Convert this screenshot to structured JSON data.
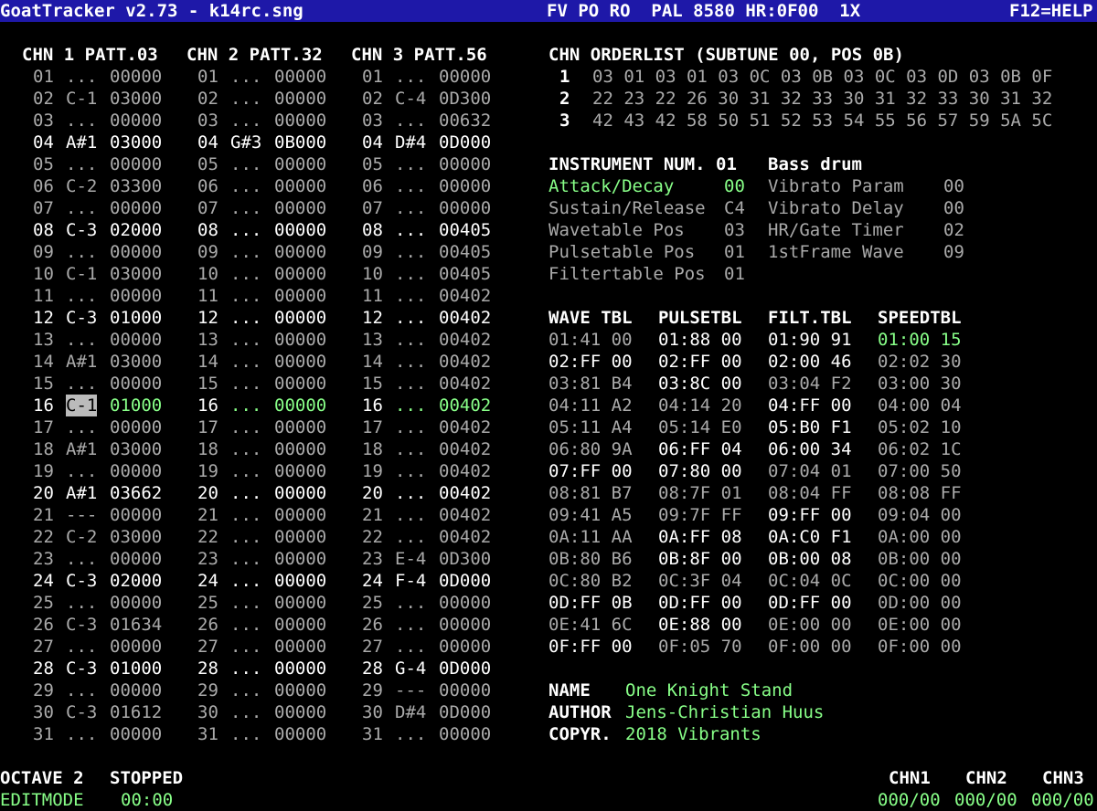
{
  "title": {
    "app": "GoatTracker v2.73 - k14rc.sng",
    "status": "FV PO RO  PAL 8580 HR:0F00  1X",
    "help": "F12=HELP"
  },
  "patterns": {
    "headers": [
      "CHN 1 PATT.03",
      "CHN 2 PATT.32",
      "CHN 3 PATT.56"
    ],
    "rows": [
      [
        [
          "01",
          "...",
          "00000"
        ],
        [
          "01",
          "...",
          "00000"
        ],
        [
          "01",
          "...",
          "00000"
        ]
      ],
      [
        [
          "02",
          "C-1",
          "03000"
        ],
        [
          "02",
          "...",
          "00000"
        ],
        [
          "02",
          "C-4",
          "0D300"
        ]
      ],
      [
        [
          "03",
          "...",
          "00000"
        ],
        [
          "03",
          "...",
          "00000"
        ],
        [
          "03",
          "...",
          "00632"
        ]
      ],
      [
        [
          "04",
          "A#1",
          "03000"
        ],
        [
          "04",
          "G#3",
          "0B000"
        ],
        [
          "04",
          "D#4",
          "0D000"
        ]
      ],
      [
        [
          "05",
          "...",
          "00000"
        ],
        [
          "05",
          "...",
          "00000"
        ],
        [
          "05",
          "...",
          "00000"
        ]
      ],
      [
        [
          "06",
          "C-2",
          "03300"
        ],
        [
          "06",
          "...",
          "00000"
        ],
        [
          "06",
          "...",
          "00000"
        ]
      ],
      [
        [
          "07",
          "...",
          "00000"
        ],
        [
          "07",
          "...",
          "00000"
        ],
        [
          "07",
          "...",
          "00000"
        ]
      ],
      [
        [
          "08",
          "C-3",
          "02000"
        ],
        [
          "08",
          "...",
          "00000"
        ],
        [
          "08",
          "...",
          "00405"
        ]
      ],
      [
        [
          "09",
          "...",
          "00000"
        ],
        [
          "09",
          "...",
          "00000"
        ],
        [
          "09",
          "...",
          "00405"
        ]
      ],
      [
        [
          "10",
          "C-1",
          "03000"
        ],
        [
          "10",
          "...",
          "00000"
        ],
        [
          "10",
          "...",
          "00405"
        ]
      ],
      [
        [
          "11",
          "...",
          "00000"
        ],
        [
          "11",
          "...",
          "00000"
        ],
        [
          "11",
          "...",
          "00402"
        ]
      ],
      [
        [
          "12",
          "C-3",
          "01000"
        ],
        [
          "12",
          "...",
          "00000"
        ],
        [
          "12",
          "...",
          "00402"
        ]
      ],
      [
        [
          "13",
          "...",
          "00000"
        ],
        [
          "13",
          "...",
          "00000"
        ],
        [
          "13",
          "...",
          "00402"
        ]
      ],
      [
        [
          "14",
          "A#1",
          "03000"
        ],
        [
          "14",
          "...",
          "00000"
        ],
        [
          "14",
          "...",
          "00402"
        ]
      ],
      [
        [
          "15",
          "...",
          "00000"
        ],
        [
          "15",
          "...",
          "00000"
        ],
        [
          "15",
          "...",
          "00402"
        ]
      ],
      [
        [
          "16",
          "C-1",
          "01000"
        ],
        [
          "16",
          "...",
          "00000"
        ],
        [
          "16",
          "...",
          "00402"
        ]
      ],
      [
        [
          "17",
          "...",
          "00000"
        ],
        [
          "17",
          "...",
          "00000"
        ],
        [
          "17",
          "...",
          "00402"
        ]
      ],
      [
        [
          "18",
          "A#1",
          "03000"
        ],
        [
          "18",
          "...",
          "00000"
        ],
        [
          "18",
          "...",
          "00402"
        ]
      ],
      [
        [
          "19",
          "...",
          "00000"
        ],
        [
          "19",
          "...",
          "00000"
        ],
        [
          "19",
          "...",
          "00402"
        ]
      ],
      [
        [
          "20",
          "A#1",
          "03662"
        ],
        [
          "20",
          "...",
          "00000"
        ],
        [
          "20",
          "...",
          "00402"
        ]
      ],
      [
        [
          "21",
          "---",
          "00000"
        ],
        [
          "21",
          "...",
          "00000"
        ],
        [
          "21",
          "...",
          "00402"
        ]
      ],
      [
        [
          "22",
          "C-2",
          "03000"
        ],
        [
          "22",
          "...",
          "00000"
        ],
        [
          "22",
          "...",
          "00402"
        ]
      ],
      [
        [
          "23",
          "...",
          "00000"
        ],
        [
          "23",
          "...",
          "00000"
        ],
        [
          "23",
          "E-4",
          "0D300"
        ]
      ],
      [
        [
          "24",
          "C-3",
          "02000"
        ],
        [
          "24",
          "...",
          "00000"
        ],
        [
          "24",
          "F-4",
          "0D000"
        ]
      ],
      [
        [
          "25",
          "...",
          "00000"
        ],
        [
          "25",
          "...",
          "00000"
        ],
        [
          "25",
          "...",
          "00000"
        ]
      ],
      [
        [
          "26",
          "C-3",
          "01634"
        ],
        [
          "26",
          "...",
          "00000"
        ],
        [
          "26",
          "...",
          "00000"
        ]
      ],
      [
        [
          "27",
          "...",
          "00000"
        ],
        [
          "27",
          "...",
          "00000"
        ],
        [
          "27",
          "...",
          "00000"
        ]
      ],
      [
        [
          "28",
          "C-3",
          "01000"
        ],
        [
          "28",
          "...",
          "00000"
        ],
        [
          "28",
          "G-4",
          "0D000"
        ]
      ],
      [
        [
          "29",
          "...",
          "00000"
        ],
        [
          "29",
          "...",
          "00000"
        ],
        [
          "29",
          "---",
          "00000"
        ]
      ],
      [
        [
          "30",
          "C-3",
          "01612"
        ],
        [
          "30",
          "...",
          "00000"
        ],
        [
          "30",
          "D#4",
          "0D000"
        ]
      ],
      [
        [
          "31",
          "...",
          "00000"
        ],
        [
          "31",
          "...",
          "00000"
        ],
        [
          "31",
          "...",
          "00000"
        ]
      ]
    ],
    "bright_rows": [
      "04",
      "08",
      "12",
      "16",
      "20",
      "24",
      "28"
    ],
    "current_row": "16"
  },
  "orderlist": {
    "header": "CHN ORDERLIST (SUBTUNE 00, POS 0B)",
    "rows": [
      {
        "chn": "1",
        "entries": "03 01 03 01 03 0C 03 0B 03 0C 03 0D 03 0B 0F"
      },
      {
        "chn": "2",
        "entries": "22 23 22 26 30 31 32 33 30 31 32 33 30 31 32"
      },
      {
        "chn": "3",
        "entries": "42 43 42 58 50 51 52 53 54 55 56 57 59 5A 5C"
      }
    ]
  },
  "instrument": {
    "header": "INSTRUMENT NUM. 01",
    "name": "Bass drum",
    "params_left": [
      {
        "label": "Attack/Decay",
        "value": "00"
      },
      {
        "label": "Sustain/Release",
        "value": "C4"
      },
      {
        "label": "Wavetable Pos",
        "value": "03"
      },
      {
        "label": "Pulsetable Pos",
        "value": "01"
      },
      {
        "label": "Filtertable Pos",
        "value": "01"
      }
    ],
    "params_right": [
      {
        "label": "Vibrato Param",
        "value": "00"
      },
      {
        "label": "Vibrato Delay",
        "value": "00"
      },
      {
        "label": "HR/Gate Timer",
        "value": "02"
      },
      {
        "label": "1stFrame Wave",
        "value": "09"
      }
    ]
  },
  "tables": {
    "headers": [
      "WAVE TBL",
      "PULSETBL",
      "FILT.TBL",
      "SPEEDTBL"
    ],
    "wave": [
      "01:41 00",
      "02:FF 00",
      "03:81 B4",
      "04:11 A2",
      "05:11 A4",
      "06:80 9A",
      "07:FF 00",
      "08:81 B7",
      "09:41 A5",
      "0A:11 AA",
      "0B:80 B6",
      "0C:80 B2",
      "0D:FF 0B",
      "0E:41 6C",
      "0F:FF 00"
    ],
    "pulse": [
      "01:88 00",
      "02:FF 00",
      "03:8C 00",
      "04:14 20",
      "05:14 E0",
      "06:FF 04",
      "07:80 00",
      "08:7F 01",
      "09:7F FF",
      "0A:FF 08",
      "0B:8F 00",
      "0C:3F 04",
      "0D:FF 00",
      "0E:88 00",
      "0F:05 70"
    ],
    "filt": [
      "01:90 91",
      "02:00 46",
      "03:04 F2",
      "04:FF 00",
      "05:B0 F1",
      "06:00 34",
      "07:04 01",
      "08:04 FF",
      "09:FF 00",
      "0A:C0 F1",
      "0B:00 08",
      "0C:04 0C",
      "0D:FF 00",
      "0E:00 00",
      "0F:00 00"
    ],
    "speed": [
      "01:00 15",
      "02:02 30",
      "03:00 30",
      "04:00 04",
      "05:02 10",
      "06:02 1C",
      "07:00 50",
      "08:08 FF",
      "09:04 00",
      "0A:00 00",
      "0B:00 00",
      "0C:00 00",
      "0D:00 00",
      "0E:00 00",
      "0F:00 00"
    ]
  },
  "song_info": {
    "name_label": "NAME",
    "name_value": "One Knight Stand",
    "author_label": "AUTHOR",
    "author_value": "Jens-Christian Huus",
    "copyr_label": "COPYR.",
    "copyr_value": "2018 Vibrants"
  },
  "footer": {
    "octave": "OCTAVE 2",
    "state": "STOPPED",
    "editmode": "EDITMODE",
    "time": "00:00",
    "chn_labels": [
      "CHN1",
      "CHN2",
      "CHN3"
    ],
    "chn_values": [
      "000/00",
      "000/00",
      "000/00"
    ]
  },
  "colors": {
    "title_bg": "#1e18a8",
    "highlight_green": "#88ff88",
    "text_gray": "#aaaaaa",
    "text_white": "#ffffff"
  }
}
